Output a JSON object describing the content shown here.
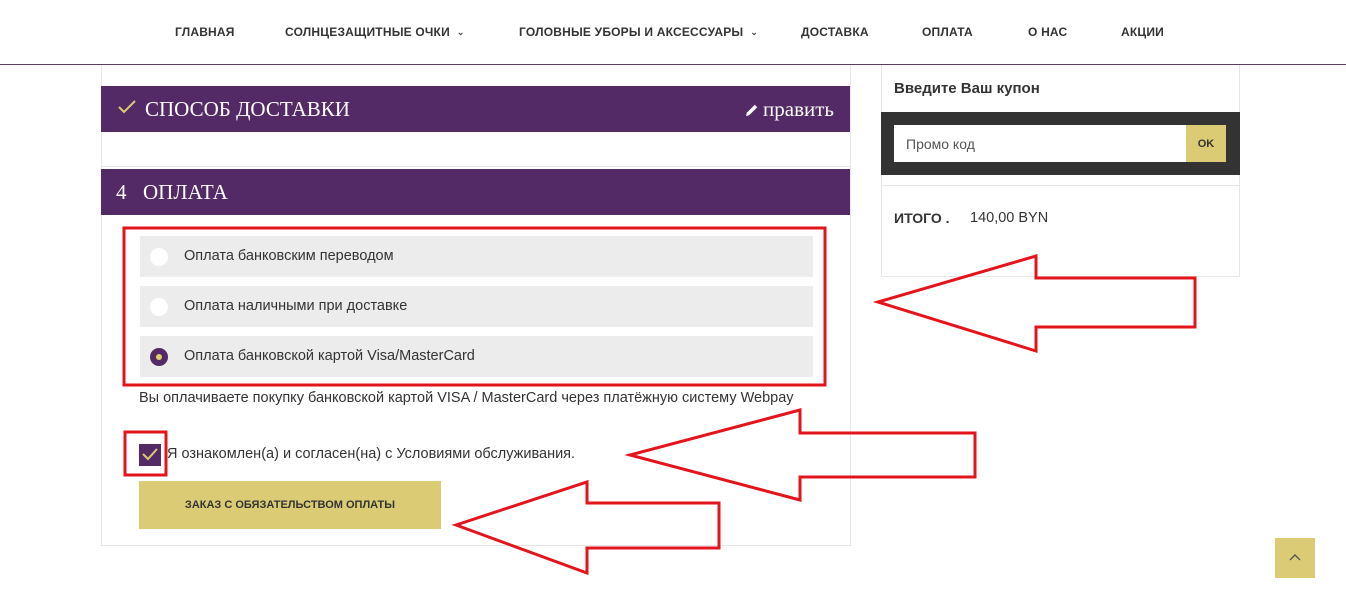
{
  "nav": {
    "items": [
      {
        "label": "ГЛАВНАЯ"
      },
      {
        "label": "СОЛНЦЕЗАЩИТНЫЕ ОЧКИ"
      },
      {
        "label": "ГОЛОВНЫЕ УБОРЫ И АКСЕССУАРЫ"
      },
      {
        "label": "ДОСТАВКА"
      },
      {
        "label": "ОПЛАТА"
      },
      {
        "label": "О НАС"
      },
      {
        "label": "АКЦИИ"
      }
    ]
  },
  "delivery_step": {
    "title": "СПОСОБ ДОСТАВКИ",
    "edit_label": "править"
  },
  "payment_step": {
    "number": "4",
    "title": "ОПЛАТА",
    "options": [
      {
        "label": "Оплата банковским переводом",
        "selected": false
      },
      {
        "label": "Оплата наличными при доставке",
        "selected": false
      },
      {
        "label": "Оплата банковской картой Visa/MasterCard",
        "selected": true
      }
    ],
    "description": "Вы оплачиваете покупку банковской картой VISA / MasterCard через платёжную систему Webpay",
    "terms_label": "Я ознакомлен(а) и согласен(на) с Условиями обслуживания.",
    "terms_checked": true,
    "order_button": "ЗАКАЗ С ОБЯЗАТЕЛЬСТВОМ ОПЛАТЫ"
  },
  "coupon": {
    "title": "Введите Ваш купон",
    "placeholder": "Промо код",
    "ok_label": "OK"
  },
  "summary": {
    "total_label": "ИТОГО .",
    "total_value": "140,00 BYN"
  },
  "colors": {
    "brand_purple": "#532a66",
    "accent_gold": "#dccb75",
    "annotation_red": "#e3141b"
  }
}
